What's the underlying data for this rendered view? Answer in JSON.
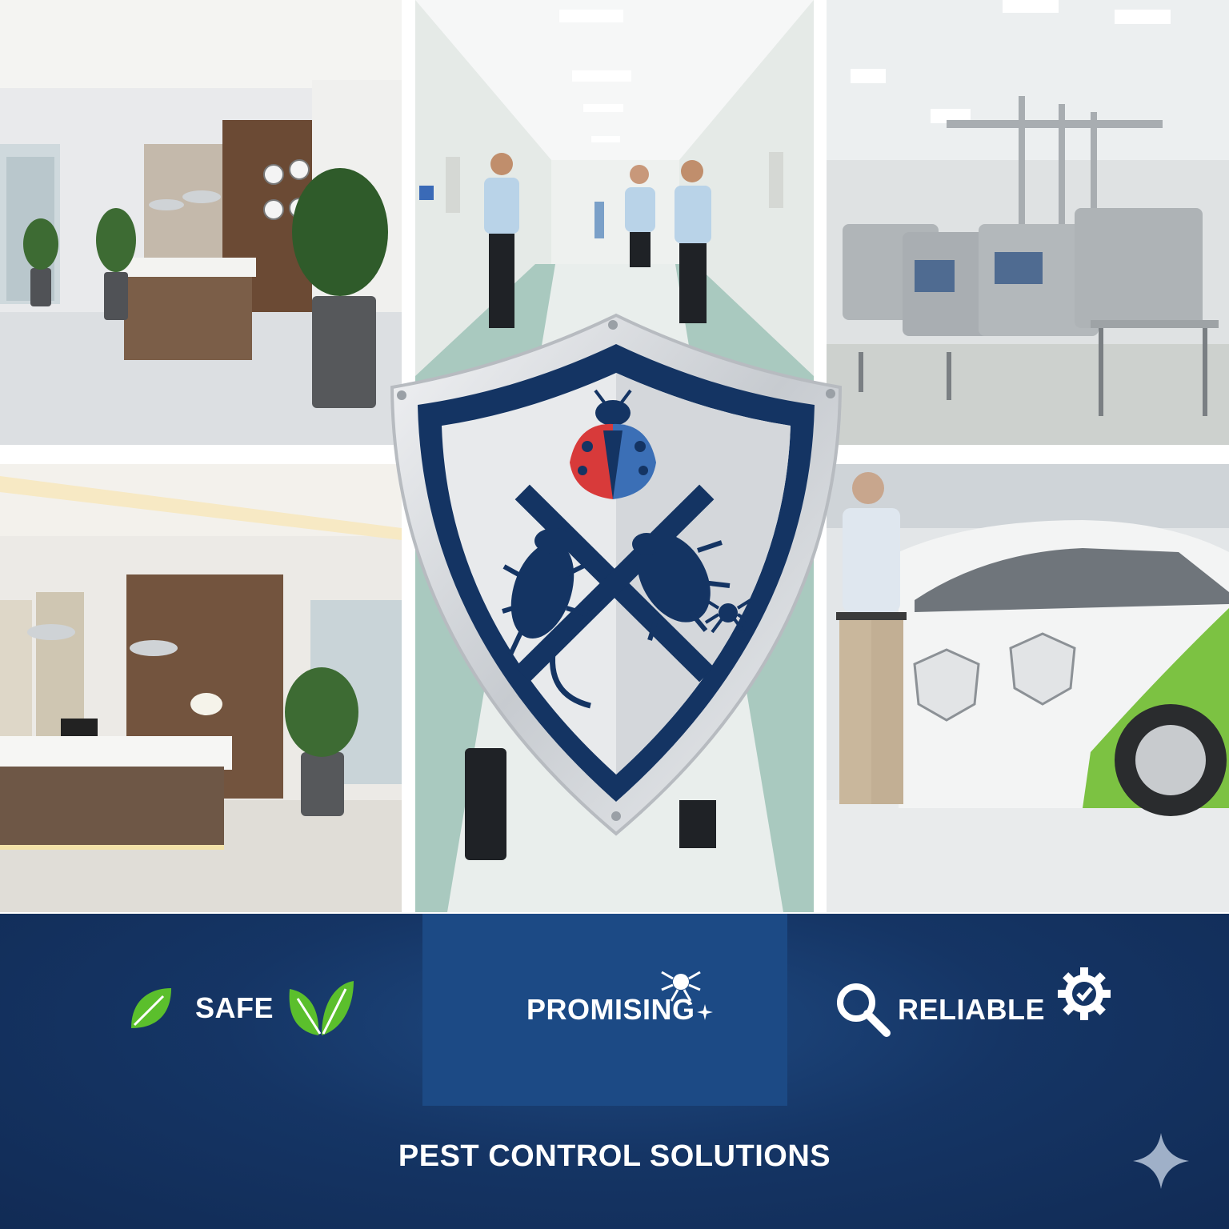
{
  "banner": {
    "features": {
      "safe": "SAFE",
      "promising": "PROMISING",
      "reliable": "RELIABLE"
    },
    "tagline": "PEST CONTROL SOLUTIONS"
  },
  "icons": [
    "leaf-icon",
    "bug-sparkle-icon",
    "magnifier-icon",
    "gear-check-icon",
    "sparkle-icon",
    "ladybug-icon",
    "cockroach-icon",
    "spider-icon",
    "rat-icon"
  ],
  "colors": {
    "navy": "#143463",
    "banner_blue": "#1c4a85",
    "leaf_green": "#5bbf2c",
    "ladybug_red": "#d83a3a",
    "ladybug_blue": "#3b6fb6",
    "shield_silver": "#d7dade"
  }
}
